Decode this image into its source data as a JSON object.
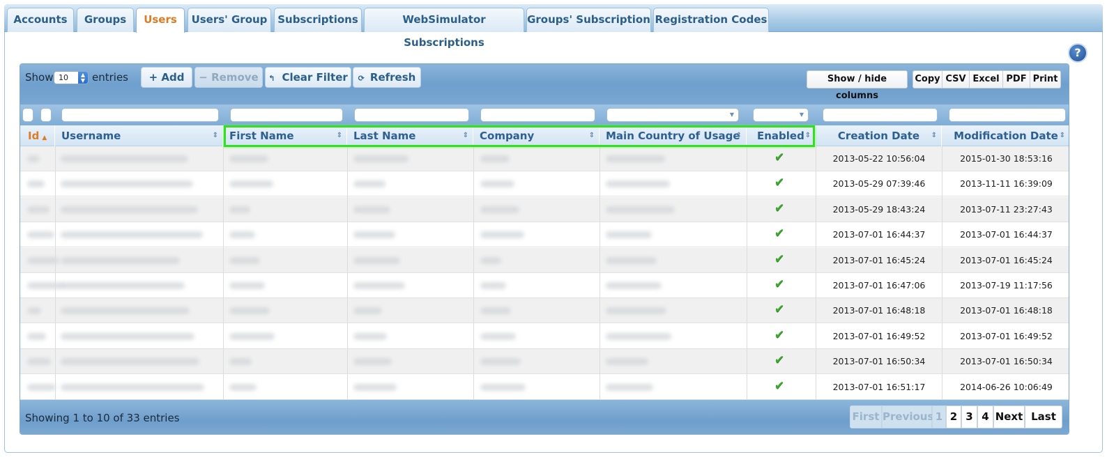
{
  "tabs": [
    {
      "label": "Accounts",
      "active": false
    },
    {
      "label": "Groups",
      "active": false
    },
    {
      "label": "Users",
      "active": true
    },
    {
      "label": "Users' Group",
      "active": false
    },
    {
      "label": "Subscriptions",
      "active": false
    },
    {
      "label": "WebSimulator Subscriptions",
      "active": false
    },
    {
      "label": "Groups' Subscription",
      "active": false
    },
    {
      "label": "Registration Codes",
      "active": false
    }
  ],
  "help_label": "?",
  "toolbar": {
    "show_label": "Show",
    "page_length": "10",
    "entries_label": "entries",
    "add_label": "+  Add",
    "remove_label": "−  Remove",
    "clear_filter_label": "Clear Filter",
    "refresh_label": "Refresh",
    "show_hide_label": "Show / hide columns",
    "copy_label": "Copy",
    "csv_label": "CSV",
    "excel_label": "Excel",
    "pdf_label": "PDF",
    "print_label": "Print"
  },
  "columns": {
    "id": "Id",
    "username": "Username",
    "first_name": "First Name",
    "last_name": "Last Name",
    "company": "Company",
    "country": "Main Country of Usage",
    "enabled": "Enabled",
    "creation": "Creation Date",
    "modification": "Modification Date"
  },
  "rows": [
    {
      "creation": "2013-05-22 10:56:04",
      "modification": "2015-01-30 18:53:16",
      "enabled": "✔"
    },
    {
      "creation": "2013-05-29 07:39:46",
      "modification": "2013-11-11 16:39:09",
      "enabled": "✔"
    },
    {
      "creation": "2013-05-29 18:43:24",
      "modification": "2013-07-11 23:27:43",
      "enabled": "✔"
    },
    {
      "creation": "2013-07-01 16:44:37",
      "modification": "2013-07-01 16:44:37",
      "enabled": "✔"
    },
    {
      "creation": "2013-07-01 16:45:24",
      "modification": "2013-07-01 16:45:24",
      "enabled": "✔"
    },
    {
      "creation": "2013-07-01 16:47:06",
      "modification": "2013-07-19 11:17:56",
      "enabled": "✔"
    },
    {
      "creation": "2013-07-01 16:48:18",
      "modification": "2013-07-01 16:48:18",
      "enabled": "✔"
    },
    {
      "creation": "2013-07-01 16:49:52",
      "modification": "2013-07-01 16:49:52",
      "enabled": "✔"
    },
    {
      "creation": "2013-07-01 16:50:34",
      "modification": "2013-07-01 16:50:34",
      "enabled": "✔"
    },
    {
      "creation": "2013-07-01 16:51:17",
      "modification": "2014-06-26 10:06:49",
      "enabled": "✔"
    }
  ],
  "footer": {
    "info": "Showing 1 to 10 of 33 entries",
    "pager": {
      "first": "First",
      "previous": "Previous",
      "pages": [
        "1",
        "2",
        "3",
        "4"
      ],
      "next": "Next",
      "last": "Last"
    }
  },
  "colors": {
    "accent": "#e07b24",
    "header_text": "#2d6091",
    "highlight_border": "#34df23",
    "check": "#3aaa2c"
  }
}
